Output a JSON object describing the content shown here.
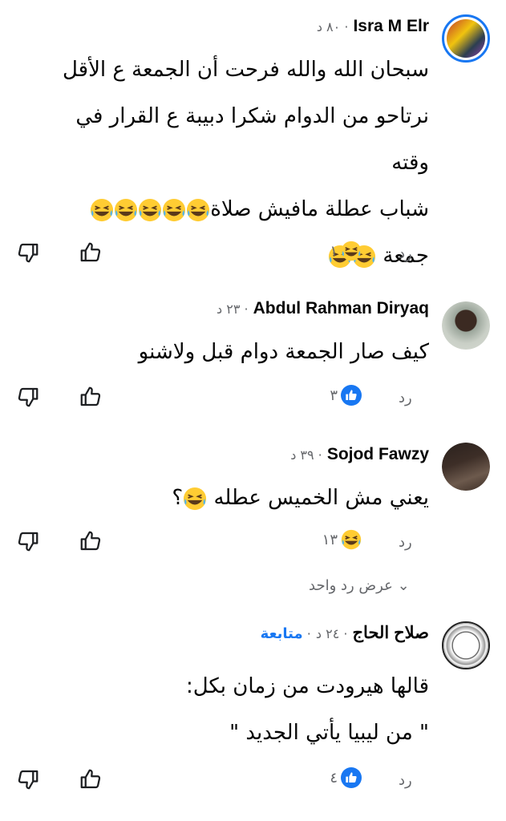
{
  "comments": [
    {
      "author": "Isra M Elr",
      "meta": "٨٠ د",
      "lines": [
        "سبحان الله والله فرحت أن الجمعة ع الأقل",
        "نرتاحو من الدوام شكرا دبيبة ع القرار في وقته",
        "شباب عطلة مافيش صلاة",
        "جمعة"
      ],
      "reaction": "haha",
      "reaction_count": "١",
      "reply": "رد"
    },
    {
      "author": "Abdul Rahman Diryaq",
      "meta": "٢٣ د",
      "lines": [
        "كيف صار الجمعة دوام قبل ولاشنو"
      ],
      "reaction": "like",
      "reaction_count": "٣",
      "reply": "رد"
    },
    {
      "author": "Sojod Fawzy",
      "meta": "٣٩ د",
      "lines": [
        "يعني مش الخميس عطله",
        "؟"
      ],
      "reaction": "haha",
      "reaction_count": "١٣",
      "reply": "رد"
    },
    {
      "author": "صلاح الحاج",
      "meta": "٢٤ د",
      "follow": "متابعة",
      "lines": [
        "قالها هيرودت من زمان بكل:",
        "\" من ليبيا يأتي الجديد \""
      ],
      "reaction": "like",
      "reaction_count": "٤",
      "reply": "رد"
    }
  ],
  "view_replies": "عرض رد واحد",
  "colors": {
    "accent": "#1877f2",
    "muted": "#65676b"
  },
  "icons": [
    "thumbs-down-icon",
    "thumbs-up-icon",
    "like-reaction-icon",
    "haha-reaction-icon",
    "laughing-emoji-icon",
    "chevron-down-icon"
  ]
}
